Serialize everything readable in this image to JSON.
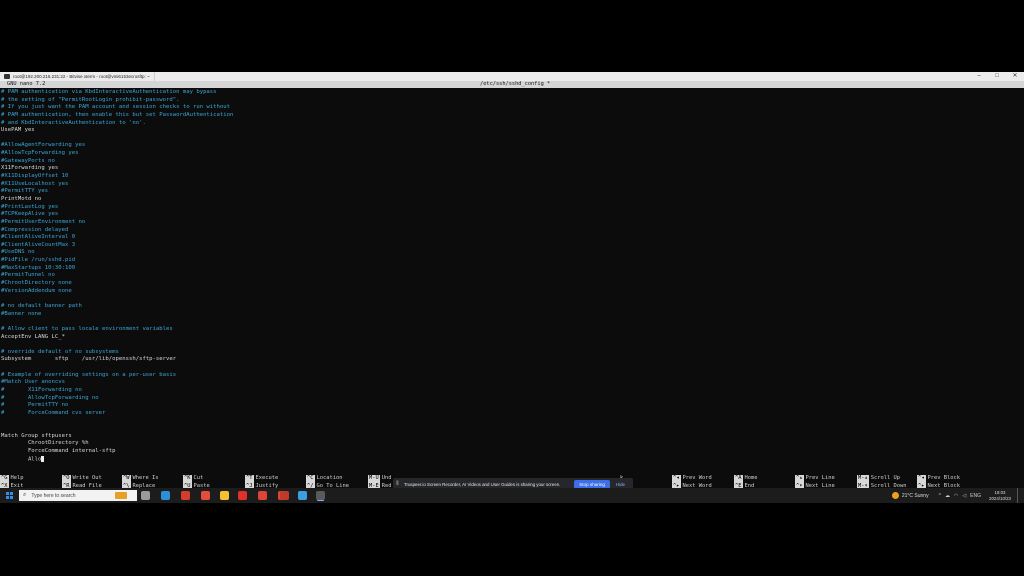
{
  "window": {
    "tabs": [
      {
        "label": "root@192.200.216.231:22 - Bitvise xterm - root@vmi6153ecrosftp: ~"
      }
    ],
    "controls": {
      "minimize": "–",
      "maximize": "□",
      "close": "✕"
    }
  },
  "nano": {
    "version": "GNU nano 7.2",
    "filename": "/etc/ssh/sshd_config *"
  },
  "code_lines": [
    {
      "t": "# PAM authentication via KbdInteractiveAuthentication may bypass",
      "c": true
    },
    {
      "t": "# the setting of \"PermitRootLogin prohibit-password\".",
      "c": true
    },
    {
      "t": "# If you just want the PAM account and session checks to run without",
      "c": true
    },
    {
      "t": "# PAM authentication, then enable this but set PasswordAuthentication",
      "c": true
    },
    {
      "t": "# and KbdInteractiveAuthentication to 'no'.",
      "c": true
    },
    {
      "t": "UsePAM yes",
      "c": false
    },
    {
      "t": "",
      "c": false
    },
    {
      "t": "#AllowAgentForwarding yes",
      "c": true
    },
    {
      "t": "#AllowTcpForwarding yes",
      "c": true
    },
    {
      "t": "#GatewayPorts no",
      "c": true
    },
    {
      "t": "X11Forwarding yes",
      "c": false
    },
    {
      "t": "#X11DisplayOffset 10",
      "c": true
    },
    {
      "t": "#X11UseLocalhost yes",
      "c": true
    },
    {
      "t": "#PermitTTY yes",
      "c": true
    },
    {
      "t": "PrintMotd no",
      "c": false
    },
    {
      "t": "#PrintLastLog yes",
      "c": true
    },
    {
      "t": "#TCPKeepAlive yes",
      "c": true
    },
    {
      "t": "#PermitUserEnvironment no",
      "c": true
    },
    {
      "t": "#Compression delayed",
      "c": true
    },
    {
      "t": "#ClientAliveInterval 0",
      "c": true
    },
    {
      "t": "#ClientAliveCountMax 3",
      "c": true
    },
    {
      "t": "#UseDNS no",
      "c": true
    },
    {
      "t": "#PidFile /run/sshd.pid",
      "c": true
    },
    {
      "t": "#MaxStartups 10:30:100",
      "c": true
    },
    {
      "t": "#PermitTunnel no",
      "c": true
    },
    {
      "t": "#ChrootDirectory none",
      "c": true
    },
    {
      "t": "#VersionAddendum none",
      "c": true
    },
    {
      "t": "",
      "c": false
    },
    {
      "t": "# no default banner path",
      "c": true
    },
    {
      "t": "#Banner none",
      "c": true
    },
    {
      "t": "",
      "c": false
    },
    {
      "t": "# Allow client to pass locale environment variables",
      "c": true
    },
    {
      "t": "AcceptEnv LANG LC_*",
      "c": false
    },
    {
      "t": "",
      "c": false
    },
    {
      "t": "# override default of no subsystems",
      "c": true
    },
    {
      "t": "Subsystem       sftp    /usr/lib/openssh/sftp-server",
      "c": false
    },
    {
      "t": "",
      "c": false
    },
    {
      "t": "# Example of overriding settings on a per-user basis",
      "c": true
    },
    {
      "t": "#Match User anoncvs",
      "c": true
    },
    {
      "t": "#       X11Forwarding no",
      "c": true
    },
    {
      "t": "#       AllowTcpForwarding no",
      "c": true
    },
    {
      "t": "#       PermitTTY no",
      "c": true
    },
    {
      "t": "#       ForceCommand cvs server",
      "c": true
    },
    {
      "t": "",
      "c": false
    },
    {
      "t": "",
      "c": false
    },
    {
      "t": "Match Group sftpusers",
      "c": false
    },
    {
      "t": "        ChrootDirectory %h",
      "c": false
    },
    {
      "t": "        ForceCommand internal-sftp",
      "c": false
    },
    {
      "t": "        Allo",
      "c": false,
      "cursor": true
    }
  ],
  "shortcuts": [
    {
      "key1": "^G",
      "label1": "Help",
      "key2": "^X",
      "label2": "Exit"
    },
    {
      "key1": "^O",
      "label1": "Write Out",
      "key2": "^R",
      "label2": "Read File"
    },
    {
      "key1": "^W",
      "label1": "Where Is",
      "key2": "^\\",
      "label2": "Replace"
    },
    {
      "key1": "^K",
      "label1": "Cut",
      "key2": "^U",
      "label2": "Paste"
    },
    {
      "key1": "^T",
      "label1": "Execute",
      "key2": "^J",
      "label2": "Justify"
    },
    {
      "key1": "^C",
      "label1": "Location",
      "key2": "^/",
      "label2": "Go To Line"
    },
    {
      "key1": "M-U",
      "label1": "Und",
      "key2": "M-E",
      "label2": "Red"
    },
    {
      "key1": "",
      "label1": "k",
      "key2": "",
      "label2": "ward"
    },
    {
      "key1": "^◂",
      "label1": "Prev Word",
      "key2": "^▸",
      "label2": "Next Word"
    },
    {
      "key1": "^A",
      "label1": "Home",
      "key2": "^E",
      "label2": "End"
    },
    {
      "key1": "^▴",
      "label1": "Prev Line",
      "key2": "^▾",
      "label2": "Next Line"
    },
    {
      "key1": "M-▴",
      "label1": "Scroll Up",
      "key2": "M-▾",
      "label2": "Scroll Down"
    },
    {
      "key1": "^◂",
      "label1": "Prev Block",
      "key2": "^▸",
      "label2": "Next Block"
    }
  ],
  "share_notice": {
    "message": "Truspeer.io Screen Recorder, AI Videos and User Guides is sharing your screen.",
    "stop_label": "Stop sharing",
    "hide_label": "Hide"
  },
  "taskbar": {
    "search_placeholder": "Type here to search",
    "weather": "21°C  Sunny",
    "lang": "ENG",
    "time": "18:03",
    "date": "2024/10/23",
    "apps": [
      {
        "name": "task-view-icon",
        "color": "#9a9a9a"
      },
      {
        "name": "edge-icon",
        "color": "#2d8fd8"
      },
      {
        "name": "chrome-icon",
        "color": "#d43c2c"
      },
      {
        "name": "chrome-profile-icon",
        "color": "#e44c3c"
      },
      {
        "name": "file-explorer-icon",
        "color": "#f2c230"
      },
      {
        "name": "acrobat-icon",
        "color": "#e0302a"
      },
      {
        "name": "chrome-alt-icon",
        "color": "#db4437"
      },
      {
        "name": "media-icon",
        "color": "#d94a2a"
      },
      {
        "name": "app-icon",
        "color": "#c0392b"
      },
      {
        "name": "network-icon",
        "color": "#3aa0e0"
      },
      {
        "name": "terminal-icon",
        "color": "#5a5a5a"
      }
    ]
  }
}
